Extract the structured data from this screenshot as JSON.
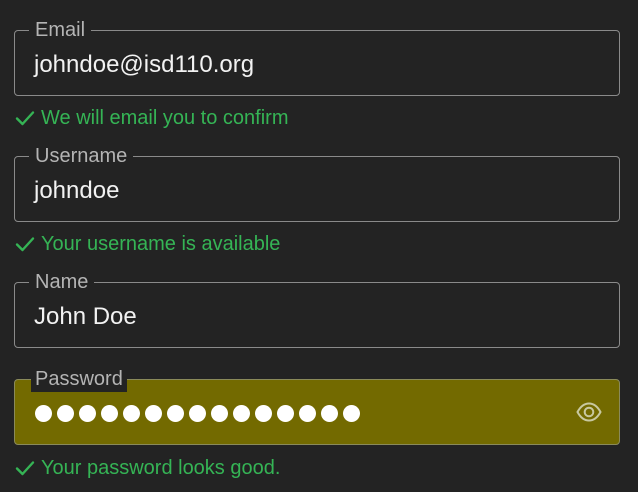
{
  "colors": {
    "background": "#232323",
    "border": "#8a8a8a",
    "label": "#b4b4b4",
    "value": "#f2f2f2",
    "success": "#35b455",
    "password_fill": "#736a00"
  },
  "email": {
    "label": "Email",
    "value": "johndoe@isd110.org",
    "helper": "We will email you to confirm",
    "helper_icon": "check-icon"
  },
  "username": {
    "label": "Username",
    "value": "johndoe",
    "helper": "Your username is available",
    "helper_icon": "check-icon"
  },
  "name": {
    "label": "Name",
    "value": "John Doe"
  },
  "password": {
    "label": "Password",
    "masked_length": 15,
    "toggle_icon": "eye-icon",
    "helper": "Your password looks good.",
    "helper_icon": "check-icon"
  }
}
